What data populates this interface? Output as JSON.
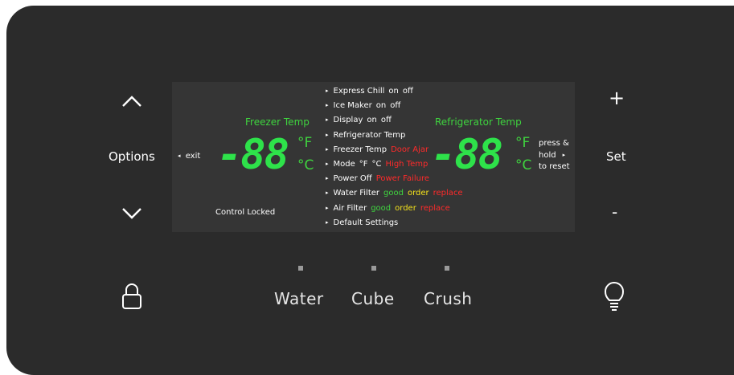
{
  "left_controls": {
    "up_icon": "chevron-up",
    "options_label": "Options",
    "down_icon": "chevron-down"
  },
  "right_controls": {
    "plus_label": "+",
    "set_label": "Set",
    "minus_label": "-"
  },
  "display": {
    "exit_label": "exit",
    "freezer_label": "Freezer Temp",
    "freezer_value": "-88",
    "refrigerator_label": "Refrigerator Temp",
    "refrigerator_value": "-88",
    "unit_f": "°F",
    "unit_c": "°C",
    "control_locked": "Control Locked",
    "press_hold": [
      "press &",
      "hold",
      "to reset"
    ],
    "menu": [
      {
        "text": "Express Chill",
        "options": [
          {
            "t": "on",
            "c": "white"
          },
          {
            "t": "off",
            "c": "white"
          }
        ]
      },
      {
        "text": "Ice Maker",
        "options": [
          {
            "t": "on",
            "c": "white"
          },
          {
            "t": "off",
            "c": "white"
          }
        ]
      },
      {
        "text": "Display",
        "options": [
          {
            "t": "on",
            "c": "white"
          },
          {
            "t": "off",
            "c": "white"
          }
        ]
      },
      {
        "text": "Refrigerator Temp",
        "options": []
      },
      {
        "text": "Freezer Temp",
        "options": [
          {
            "t": "Door Ajar",
            "c": "red"
          }
        ]
      },
      {
        "text": "Mode",
        "options": [
          {
            "t": "°F",
            "c": "white"
          },
          {
            "t": "°C",
            "c": "white"
          },
          {
            "t": "High Temp",
            "c": "red"
          }
        ]
      },
      {
        "text": "Power Off",
        "options": [
          {
            "t": "Power Failure",
            "c": "red"
          }
        ]
      },
      {
        "text": "Water Filter",
        "options": [
          {
            "t": "good",
            "c": "green"
          },
          {
            "t": "order",
            "c": "yellow"
          },
          {
            "t": "replace",
            "c": "red"
          }
        ]
      },
      {
        "text": "Air Filter",
        "options": [
          {
            "t": "good",
            "c": "green"
          },
          {
            "t": "order",
            "c": "yellow"
          },
          {
            "t": "replace",
            "c": "red"
          }
        ]
      },
      {
        "text": "Default Settings",
        "options": []
      }
    ]
  },
  "bottom_controls": {
    "lock_icon": "lock",
    "water_label": "Water",
    "cube_label": "Cube",
    "crush_label": "Crush",
    "light_icon": "lightbulb"
  },
  "colors": {
    "panel": "#2b2b2b",
    "lcd": "#353535",
    "green": "#3fd43f",
    "yellow": "#f3e21c",
    "red": "#ff2a2a"
  }
}
